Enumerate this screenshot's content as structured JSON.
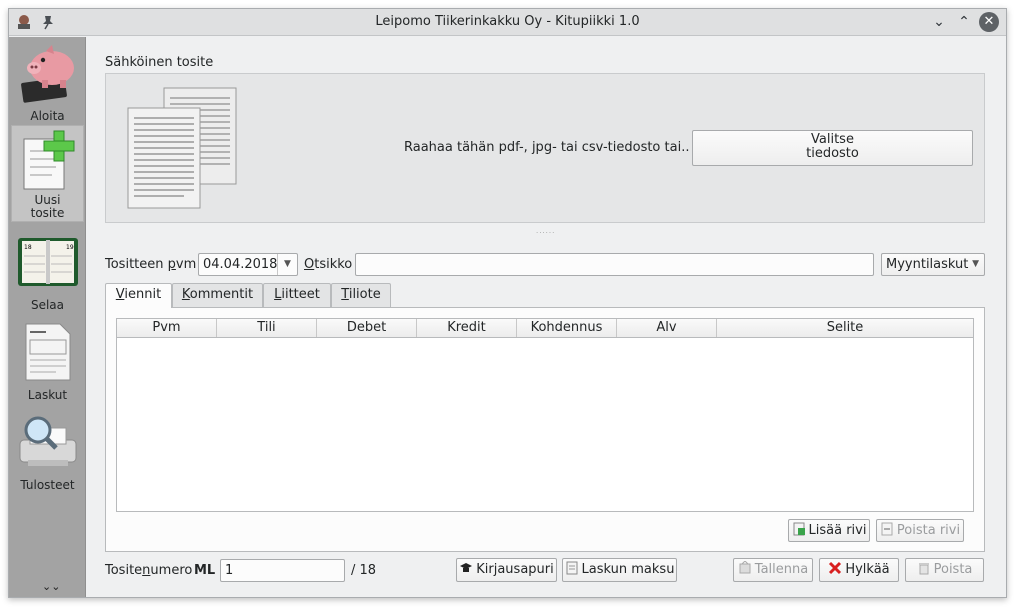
{
  "window": {
    "title": "Leipomo Tiikerinkakku Oy - Kitupiikki 1.0"
  },
  "sidebar": {
    "items": [
      {
        "label": "Aloita"
      },
      {
        "label": "Uusi\ntosite"
      },
      {
        "label": "Selaa"
      },
      {
        "label": "Laskut"
      },
      {
        "label": "Tulosteet"
      }
    ],
    "more": "»"
  },
  "attachment": {
    "section_title": "Sähköinen tosite",
    "drop_hint": "Raahaa tähän pdf-, jpg- tai csv-tiedosto tai..",
    "choose_button": "Valitse\ntiedosto",
    "splitter": "......"
  },
  "voucher": {
    "date_label_pre": "Tositteen ",
    "date_label_u": "p",
    "date_label_post": "vm",
    "date_value": "04.04.2018",
    "title_label_u": "O",
    "title_label_post": "tsikko",
    "title_value": "",
    "type_value": "Myyntilaskut"
  },
  "tabs": [
    {
      "u": "V",
      "rest": "iennit"
    },
    {
      "u": "K",
      "rest": "ommentit"
    },
    {
      "u": "L",
      "rest": "iitteet"
    },
    {
      "u": "T",
      "rest": "iliote"
    }
  ],
  "table": {
    "columns": [
      "Pvm",
      "Tili",
      "Debet",
      "Kredit",
      "Kohdennus",
      "Alv",
      "Selite"
    ],
    "rows": []
  },
  "row_actions": {
    "add": "Lisää rivi",
    "remove": "Poista rivi"
  },
  "footer": {
    "number_label_pre": "Tosite",
    "number_label_u": "n",
    "number_label_post": "umero",
    "series": "ML",
    "number_value": "1",
    "count": "/ 18",
    "assistant": "Kirjausapuri",
    "invoice_payment": "Laskun maksu",
    "save": "Tallenna",
    "reject": "Hylkää",
    "delete": "Poista"
  },
  "colors": {
    "sidebar_bg": "#a3a3a3",
    "reject_icon": "#d81f1f",
    "add_icon": "#3aa34a"
  }
}
